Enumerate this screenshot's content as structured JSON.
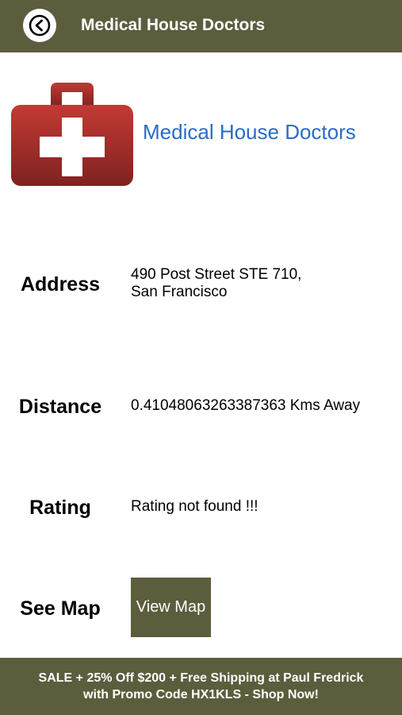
{
  "header": {
    "title": "Medical House Doctors",
    "back_icon": "back-arrow-circle-icon"
  },
  "business": {
    "name": "Medical House Doctors",
    "logo_icon": "medical-kit-icon"
  },
  "details": {
    "address_label": "Address",
    "address_line1": "490 Post Street STE 710,",
    "address_line2": "San Francisco",
    "distance_label": "Distance",
    "distance_value": "0.41048063263387363 Kms Away",
    "rating_label": "Rating",
    "rating_value": "Rating not found !!!",
    "map_label": "See Map",
    "view_map_button": "View Map"
  },
  "promo": {
    "line1": "SALE + 25% Off $200 + Free Shipping at Paul Fredrick",
    "line2": "with Promo Code HX1KLS - Shop Now!"
  },
  "colors": {
    "bar_background": "#5c5d3d",
    "link_blue": "#2c6bc6",
    "logo_red": "#a0302c"
  }
}
